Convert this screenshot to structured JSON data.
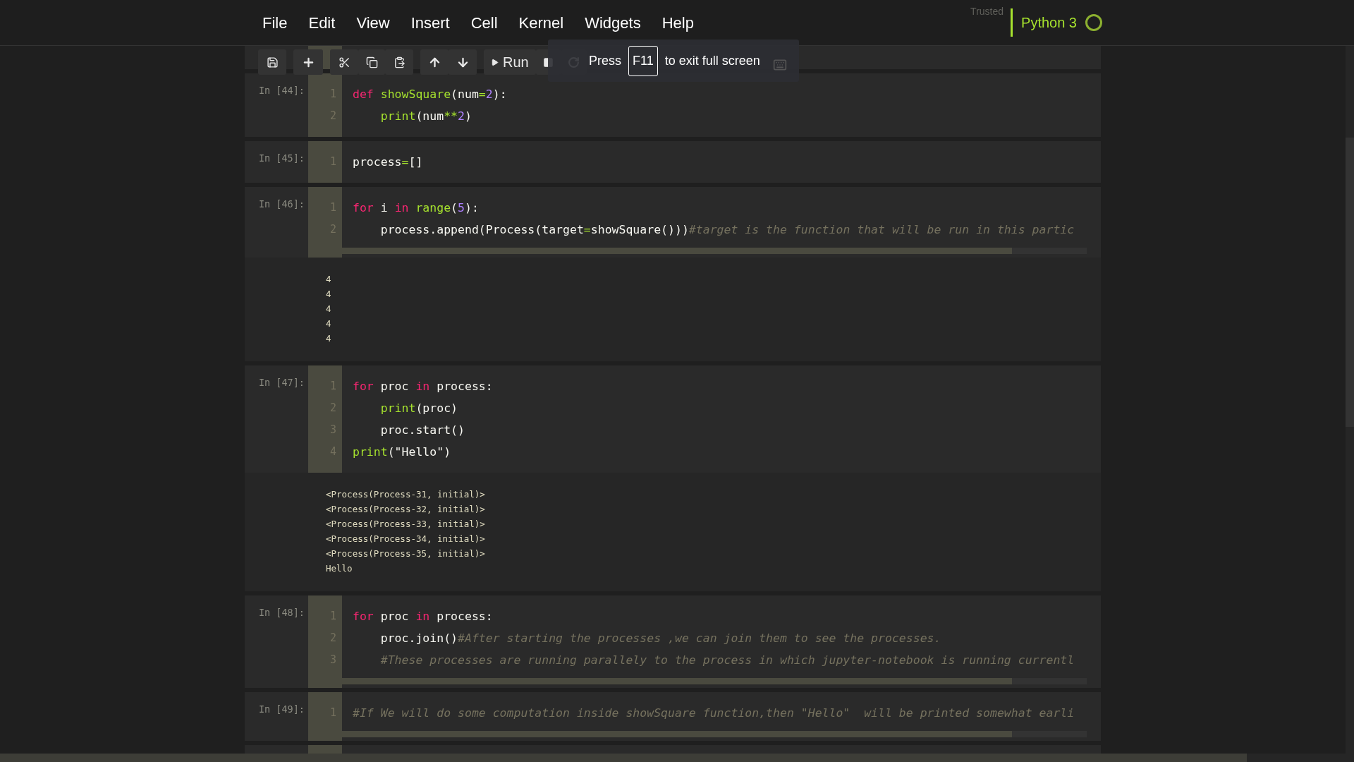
{
  "menu": [
    "File",
    "Edit",
    "View",
    "Insert",
    "Cell",
    "Kernel",
    "Widgets",
    "Help"
  ],
  "kernel": {
    "trusted": "Trusted",
    "name": "Python 3",
    "busy": false
  },
  "toolbar": {
    "run_label": "Run"
  },
  "fullscreen_notice": {
    "before": "Press",
    "key": "F11",
    "after": "to exit full screen"
  },
  "cells": [
    {
      "prompt": "In [44]:",
      "scrollbar": false,
      "lines": [
        {
          "number": "1",
          "tokens": [
            {
              "kind": "keyword",
              "text": "def"
            },
            {
              "kind": "function",
              "text": " showSquare"
            },
            {
              "kind": "plain",
              "text": "(num"
            },
            {
              "kind": "operator",
              "text": "="
            },
            {
              "kind": "number",
              "text": "2"
            },
            {
              "kind": "plain",
              "text": "):"
            }
          ]
        },
        {
          "number": "2",
          "tokens": [
            {
              "kind": "function",
              "text": "    print"
            },
            {
              "kind": "plain",
              "text": "(num"
            },
            {
              "kind": "operator",
              "text": "**"
            },
            {
              "kind": "number",
              "text": "2"
            },
            {
              "kind": "plain",
              "text": ")"
            }
          ]
        }
      ]
    },
    {
      "prompt": "In [45]:",
      "scrollbar": false,
      "lines": [
        {
          "number": "1",
          "tokens": [
            {
              "kind": "plain",
              "text": "process"
            },
            {
              "kind": "operator",
              "text": "="
            },
            {
              "kind": "plain",
              "text": "[]"
            }
          ]
        }
      ]
    },
    {
      "prompt": "In [46]:",
      "scrollbar": true,
      "lines": [
        {
          "number": "1",
          "tokens": [
            {
              "kind": "keyword",
              "text": "for"
            },
            {
              "kind": "plain",
              "text": " i "
            },
            {
              "kind": "keyword",
              "text": "in"
            },
            {
              "kind": "function",
              "text": " range"
            },
            {
              "kind": "plain",
              "text": "("
            },
            {
              "kind": "number",
              "text": "5"
            },
            {
              "kind": "plain",
              "text": "):"
            }
          ]
        },
        {
          "number": "2",
          "tokens": [
            {
              "kind": "plain",
              "text": "    process.append(Process(target"
            },
            {
              "kind": "operator",
              "text": "="
            },
            {
              "kind": "plain",
              "text": "showSquare()))"
            },
            {
              "kind": "comment",
              "text": "#target is the function that will be run in this partic"
            }
          ]
        }
      ],
      "output": [
        "4",
        "4",
        "4",
        "4",
        "4"
      ]
    },
    {
      "prompt": "In [47]:",
      "scrollbar": false,
      "lines": [
        {
          "number": "1",
          "tokens": [
            {
              "kind": "keyword",
              "text": "for"
            },
            {
              "kind": "plain",
              "text": " proc "
            },
            {
              "kind": "keyword",
              "text": "in"
            },
            {
              "kind": "plain",
              "text": " process:"
            }
          ]
        },
        {
          "number": "2",
          "tokens": [
            {
              "kind": "function",
              "text": "    print"
            },
            {
              "kind": "plain",
              "text": "(proc)"
            }
          ]
        },
        {
          "number": "3",
          "tokens": [
            {
              "kind": "plain",
              "text": "    proc.start()"
            }
          ]
        },
        {
          "number": "4",
          "tokens": [
            {
              "kind": "function",
              "text": "print"
            },
            {
              "kind": "plain",
              "text": "(\"Hello\")"
            }
          ]
        }
      ],
      "output": [
        "<Process(Process-31, initial)>",
        "<Process(Process-32, initial)>",
        "<Process(Process-33, initial)>",
        "<Process(Process-34, initial)>",
        "<Process(Process-35, initial)>",
        "Hello"
      ]
    },
    {
      "prompt": "In [48]:",
      "scrollbar": true,
      "lines": [
        {
          "number": "1",
          "tokens": [
            {
              "kind": "keyword",
              "text": "for"
            },
            {
              "kind": "plain",
              "text": " proc "
            },
            {
              "kind": "keyword",
              "text": "in"
            },
            {
              "kind": "plain",
              "text": " process:"
            }
          ]
        },
        {
          "number": "2",
          "tokens": [
            {
              "kind": "plain",
              "text": "    proc.join()"
            },
            {
              "kind": "comment",
              "text": "#After starting the processes ,we can join them to see the processes."
            }
          ]
        },
        {
          "number": "3",
          "tokens": [
            {
              "kind": "comment",
              "text": "    #These processes are running parallely to the process in which jupyter-notebook is running currentl"
            }
          ]
        }
      ]
    },
    {
      "prompt": "In [49]:",
      "scrollbar": true,
      "lines": [
        {
          "number": "1",
          "tokens": [
            {
              "kind": "comment",
              "text": "#If We will do some computation inside showSquare function,then \"Hello\"  will be printed somewhat earli"
            }
          ]
        }
      ]
    }
  ]
}
